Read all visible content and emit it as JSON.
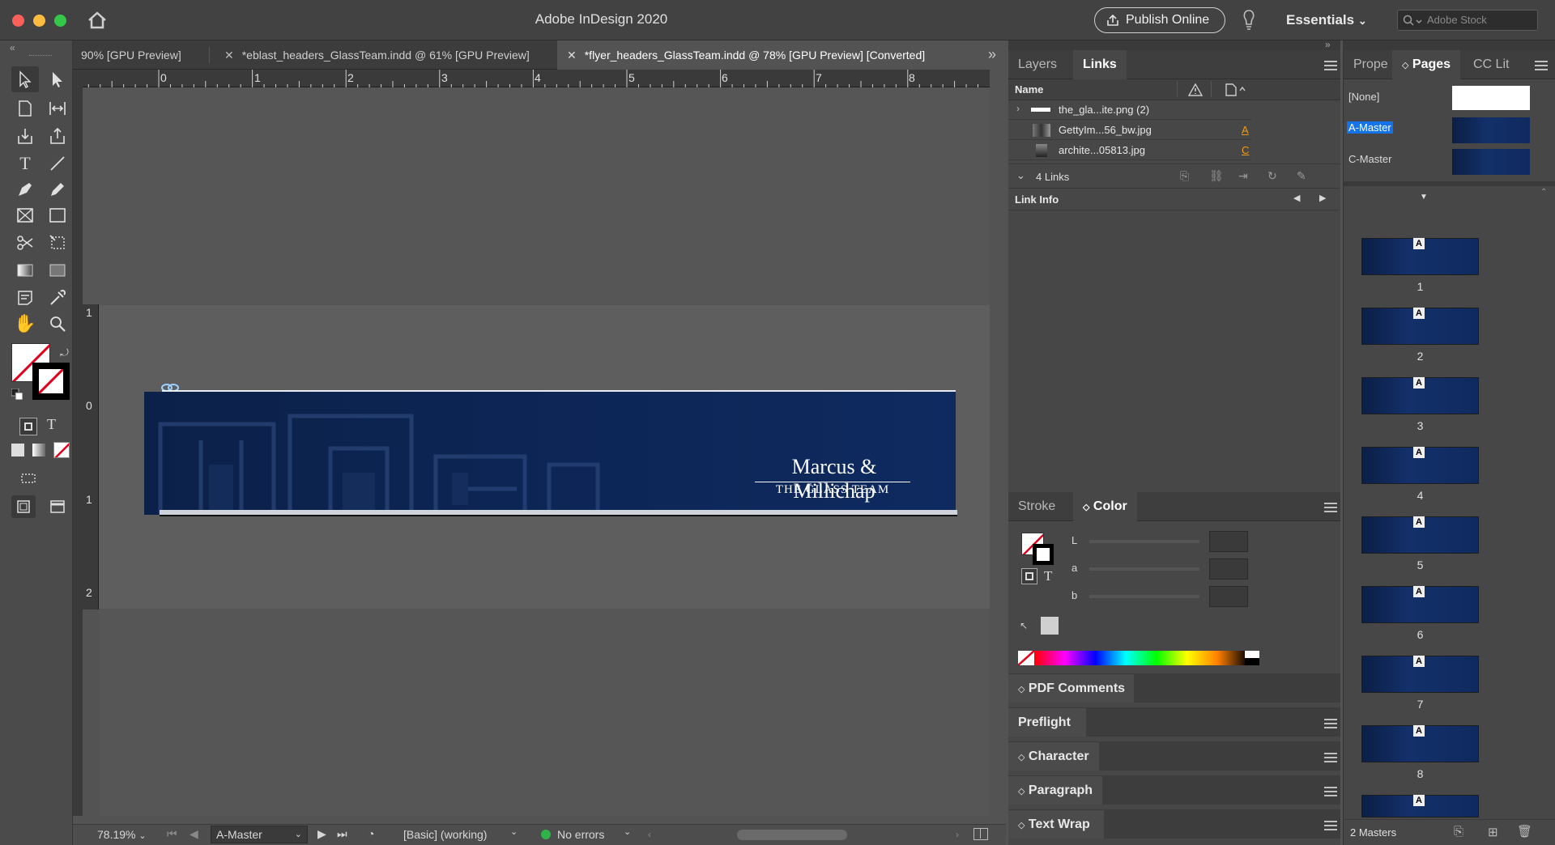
{
  "app": {
    "title": "Adobe InDesign 2020",
    "publish_label": "Publish Online",
    "workspace_label": "Essentials",
    "stock_placeholder": "Adobe Stock"
  },
  "doc_tabs": [
    {
      "label": "90% [GPU Preview]",
      "active": false
    },
    {
      "label": "*eblast_headers_GlassTeam.indd @ 61% [GPU Preview]",
      "active": false
    },
    {
      "label": "*flyer_headers_GlassTeam.indd @ 78% [GPU Preview] [Converted]",
      "active": true
    }
  ],
  "ruler": {
    "h_marks": [
      "0",
      "1",
      "2",
      "3",
      "4",
      "5",
      "6",
      "7",
      "8"
    ],
    "v_marks": [
      "1",
      "0",
      "1",
      "2"
    ]
  },
  "banner": {
    "logo_text": "Marcus & Millichap",
    "logo_subtitle": "THE GLASS TEAM"
  },
  "status": {
    "zoom": "78.19%",
    "page": "A-Master",
    "profile": "[Basic] (working)",
    "errors": "No errors"
  },
  "links_panel": {
    "tabs": [
      "Layers",
      "Links"
    ],
    "active_tab": "Links",
    "column_name": "Name",
    "items": [
      {
        "name": "the_gla...ite.png (2)",
        "page": ""
      },
      {
        "name": "GettyIm...56_bw.jpg",
        "page": "A"
      },
      {
        "name": "archite...05813.jpg",
        "page": "C"
      }
    ],
    "count_label": "4 Links",
    "link_info_label": "Link Info"
  },
  "color_panel": {
    "tabs": [
      "Stroke",
      "Color"
    ],
    "active_tab": "Color",
    "channels": [
      "L",
      "a",
      "b"
    ]
  },
  "collapsed_panels": [
    "PDF Comments",
    "Preflight",
    "Character",
    "Paragraph",
    "Text Wrap"
  ],
  "pages_panel": {
    "tabs": [
      "Prope",
      "Pages",
      "CC Lit"
    ],
    "active_tab": "Pages",
    "masters": [
      {
        "name": "[None]",
        "selected": false
      },
      {
        "name": "A-Master",
        "selected": true
      },
      {
        "name": "C-Master",
        "selected": false
      }
    ],
    "pages": [
      {
        "num": "1",
        "master": "A"
      },
      {
        "num": "2",
        "master": "A"
      },
      {
        "num": "3",
        "master": "A"
      },
      {
        "num": "4",
        "master": "A"
      },
      {
        "num": "5",
        "master": "A"
      },
      {
        "num": "6",
        "master": "A"
      },
      {
        "num": "7",
        "master": "A"
      },
      {
        "num": "8",
        "master": "A"
      },
      {
        "num": "",
        "master": "A"
      }
    ],
    "footer_label": "2 Masters"
  },
  "colors": {
    "accent": "#1473e6",
    "banner": "#0d2657",
    "status_ok": "#2fb44a"
  }
}
